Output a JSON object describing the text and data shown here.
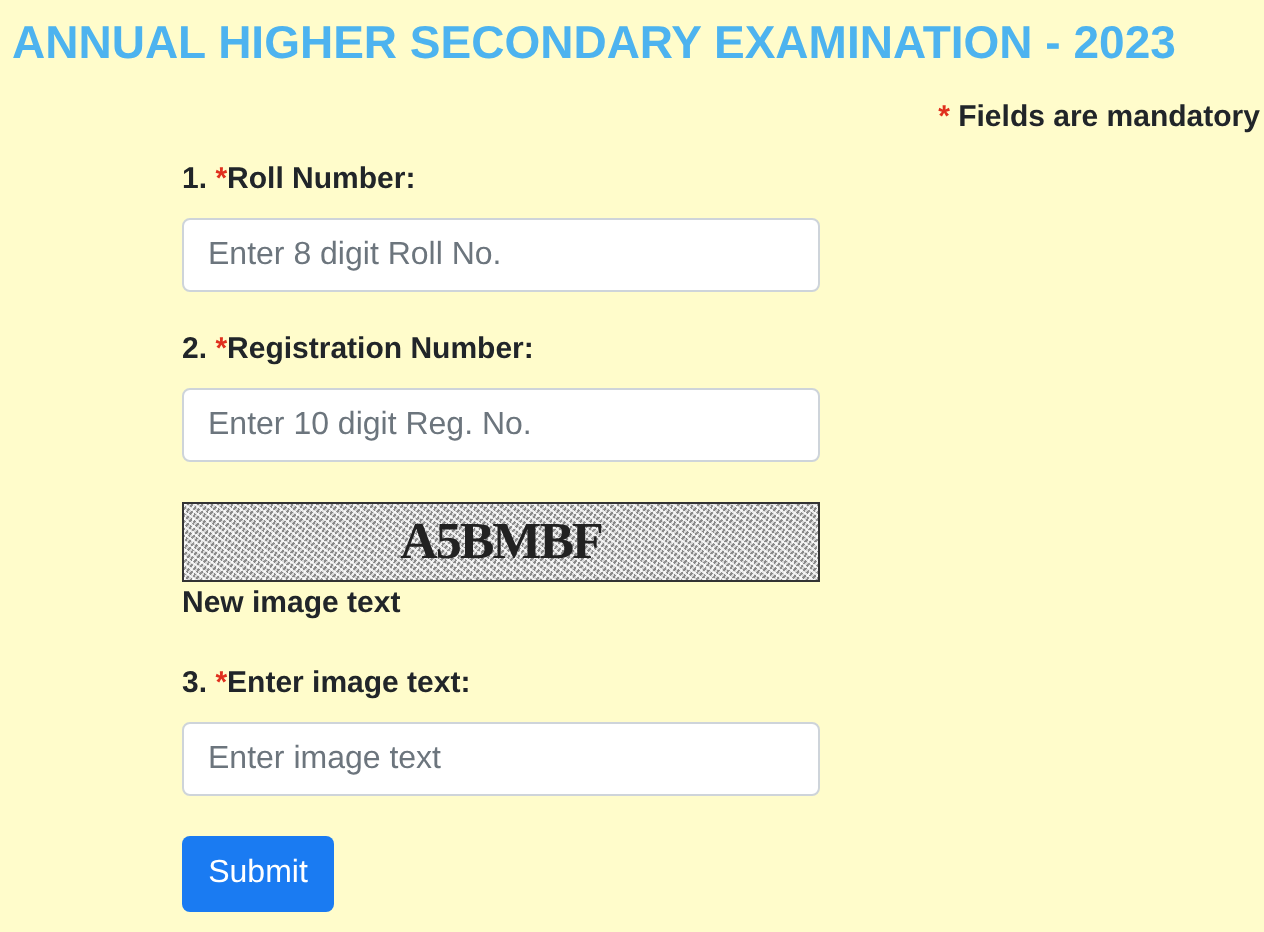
{
  "title": "ANNUAL HIGHER SECONDARY EXAMINATION - 2023",
  "mandatory_note": {
    "mark": "*",
    "text": "Fields are mandatory"
  },
  "items": [
    {
      "kind": "input",
      "number": "1.",
      "mark": "*",
      "label": "Roll Number:",
      "placeholder": "Enter 8 digit Roll No."
    },
    {
      "kind": "input",
      "number": "2.",
      "mark": "*",
      "label": "Registration Number:",
      "placeholder": "Enter 10 digit Reg. No."
    },
    {
      "kind": "captcha",
      "text": "A5BMBF",
      "caption": "New image text"
    },
    {
      "kind": "input",
      "number": "3.",
      "mark": "*",
      "label": "Enter image text:",
      "placeholder": "Enter image text"
    }
  ],
  "submit": "Submit"
}
